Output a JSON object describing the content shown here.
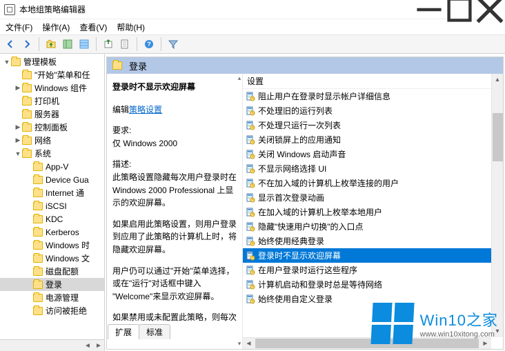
{
  "window": {
    "title": "本地组策略编辑器"
  },
  "menu": {
    "file": "文件(F)",
    "action": "操作(A)",
    "view": "查看(V)",
    "help": "帮助(H)"
  },
  "toolbar": {
    "icons": [
      "back",
      "forward",
      "up",
      "panel1",
      "panel2",
      "export",
      "doc",
      "help",
      "filter"
    ]
  },
  "tree": {
    "root": "管理模板",
    "items": [
      {
        "indent": 1,
        "twisty": "",
        "label": "\"开始\"菜单和任"
      },
      {
        "indent": 1,
        "twisty": "▶",
        "label": "Windows 组件"
      },
      {
        "indent": 1,
        "twisty": "",
        "label": "打印机"
      },
      {
        "indent": 1,
        "twisty": "",
        "label": "服务器"
      },
      {
        "indent": 1,
        "twisty": "▶",
        "label": "控制面板"
      },
      {
        "indent": 1,
        "twisty": "▶",
        "label": "网络"
      },
      {
        "indent": 1,
        "twisty": "▼",
        "label": "系统"
      },
      {
        "indent": 2,
        "twisty": "",
        "label": "App-V"
      },
      {
        "indent": 2,
        "twisty": "",
        "label": "Device Gua"
      },
      {
        "indent": 2,
        "twisty": "",
        "label": "Internet 通"
      },
      {
        "indent": 2,
        "twisty": "",
        "label": "iSCSI"
      },
      {
        "indent": 2,
        "twisty": "",
        "label": "KDC"
      },
      {
        "indent": 2,
        "twisty": "",
        "label": "Kerberos"
      },
      {
        "indent": 2,
        "twisty": "",
        "label": "Windows 时"
      },
      {
        "indent": 2,
        "twisty": "",
        "label": "Windows 文"
      },
      {
        "indent": 2,
        "twisty": "",
        "label": "磁盘配额"
      },
      {
        "indent": 2,
        "twisty": "",
        "label": "登录",
        "selected": true
      },
      {
        "indent": 2,
        "twisty": "",
        "label": "电源管理"
      },
      {
        "indent": 2,
        "twisty": "",
        "label": "访问被拒绝"
      }
    ]
  },
  "header": {
    "title": "登录"
  },
  "description": {
    "title": "登录时不显示欢迎屏幕",
    "edit_label": "编辑",
    "edit_link": "策略设置",
    "req_label": "要求:",
    "req_value": "仅 Windows 2000",
    "desc_label": "描述:",
    "desc_p1": "此策略设置隐藏每次用户登录时在 Windows 2000 Professional 上显示的欢迎屏幕。",
    "desc_p2": "如果启用此策略设置，则用户登录到应用了此策略的计算机上时，将隐藏欢迎屏幕。",
    "desc_p3": "用户仍可以通过\"开始\"菜单选择，或在\"运行\"对话框中键入 \"Welcome\"来显示欢迎屏幕。",
    "desc_p4": "如果禁用或未配置此策略，则每次"
  },
  "settings": {
    "header": "设置",
    "items": [
      "阻止用户在登录时显示帐户详细信息",
      "不处理旧的运行列表",
      "不处理只运行一次列表",
      "关闭锁屏上的应用通知",
      "关闭 Windows 启动声音",
      "不显示网络选择 UI",
      "不在加入域的计算机上枚举连接的用户",
      "显示首次登录动画",
      "在加入域的计算机上枚举本地用户",
      "隐藏\"快速用户切换\"的入口点",
      "始终使用经典登录",
      "登录时不显示欢迎屏幕",
      "在用户登录时运行这些程序",
      "计算机启动和登录时总是等待网络",
      "始终使用自定义登录"
    ],
    "selected_index": 11
  },
  "tabs": {
    "extended": "扩展",
    "standard": "标准"
  },
  "watermark": {
    "brand": "Win10之家",
    "url": "www.win10xitong.com"
  }
}
